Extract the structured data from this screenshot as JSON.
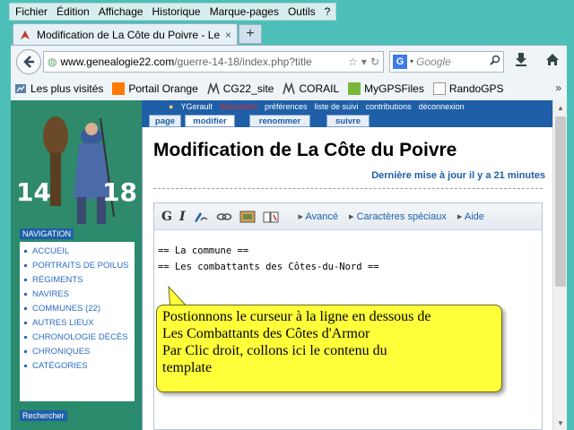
{
  "menubar": {
    "items": [
      "Fichier",
      "Édition",
      "Affichage",
      "Historique",
      "Marque-pages",
      "Outils",
      "?"
    ]
  },
  "tab": {
    "title": "Modification de La Côte du Poivre - Les ...",
    "close": "×",
    "new_tab": "+"
  },
  "navbar": {
    "url_domain": "www.genealogie22.com",
    "url_path": "/guerre-14-18/index.php?title",
    "search_placeholder": "Google",
    "search_engine": "G"
  },
  "bookmarks": {
    "items": [
      {
        "label": "Les plus visités",
        "icon": "bookmark-icon"
      },
      {
        "label": "Portail Orange",
        "icon": "orange-icon"
      },
      {
        "label": "CG22_site",
        "icon": "cg22-icon"
      },
      {
        "label": "CORAIL",
        "icon": "corail-icon"
      },
      {
        "label": "MyGPSFiles",
        "icon": "mygps-icon"
      },
      {
        "label": "RandoGPS",
        "icon": "page-icon"
      }
    ],
    "more": "»"
  },
  "site": {
    "logo_left": "14",
    "logo_right": "18",
    "nav_heading": "NAVIGATION",
    "nav_items": [
      "ACCUEIL",
      "PORTRAITS DE POILUS",
      "RÉGIMENTS",
      "NAVIRES",
      "COMMUNES (22)",
      "AUTRES LIEUX",
      "CHRONOLOGIE DÉCÈS",
      "CHRONIQUES",
      "CATÉGORIES"
    ],
    "search_heading": "Rechercher"
  },
  "userbar": {
    "user": "YGerault",
    "discussion": "discussion",
    "preferences": "préférences",
    "watchlist": "liste de suivi",
    "contributions": "contributions",
    "logout": "déconnexion"
  },
  "page_tabs": [
    "page",
    "modifier",
    "renommer",
    "suivre"
  ],
  "article": {
    "title": "Modification de La Côte du Poivre",
    "updated": "Dernière mise à jour il y a 21 minutes"
  },
  "editor": {
    "bold": "G",
    "italic": "I",
    "advanced": "Avancé",
    "special_chars": "Caractères spéciaux",
    "help": "Aide",
    "lines": [
      "== La commune ==",
      "== Les combattants des Côtes-du-Nord =="
    ]
  },
  "callout": {
    "lines": [
      "Postionnons le curseur à la ligne en dessous de",
      "Les Combattants des Côtes d'Armor",
      "Par Clic droit, collons ici le contenu du",
      "template"
    ]
  },
  "colors": {
    "desktop": "#4cc0b8",
    "site_green": "#2a8a6c",
    "site_blue": "#1e5fa8",
    "callout_yellow": "#ffff3a"
  }
}
